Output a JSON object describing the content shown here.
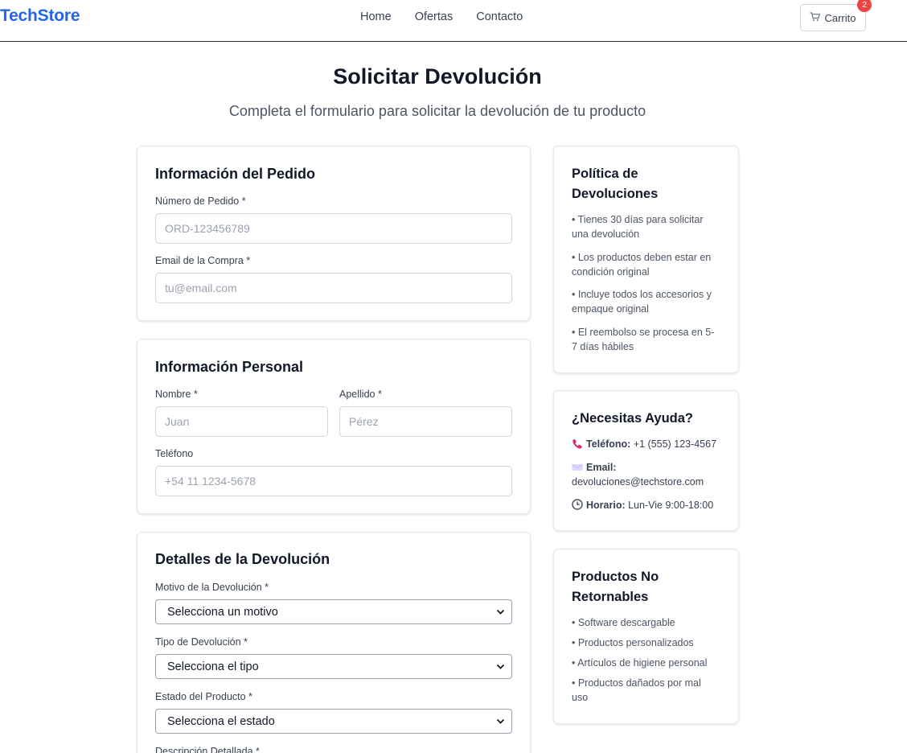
{
  "header": {
    "brand": "TechStore",
    "nav": [
      "Home",
      "Ofertas",
      "Contacto"
    ],
    "cart_label": "Carrito",
    "cart_count": "2"
  },
  "page": {
    "title": "Solicitar Devolución",
    "subtitle": "Completa el formulario para solicitar la devolución de tu producto"
  },
  "order_info": {
    "title": "Información del Pedido",
    "order_number_label": "Número de Pedido *",
    "order_number_placeholder": "ORD-123456789",
    "email_label": "Email de la Compra *",
    "email_placeholder": "tu@email.com"
  },
  "personal_info": {
    "title": "Información Personal",
    "first_name_label": "Nombre *",
    "first_name_placeholder": "Juan",
    "last_name_label": "Apellido *",
    "last_name_placeholder": "Pérez",
    "phone_label": "Teléfono",
    "phone_placeholder": "+54 11 1234-5678"
  },
  "return_details": {
    "title": "Detalles de la Devolución",
    "reason_label": "Motivo de la Devolución *",
    "reason_value": "Selecciona un motivo",
    "type_label": "Tipo de Devolución *",
    "type_value": "Selecciona el tipo",
    "condition_label": "Estado del Producto *",
    "condition_value": "Selecciona el estado",
    "description_label": "Descripción Detallada *"
  },
  "policy": {
    "title": "Política de Devoluciones",
    "items": [
      "• Tienes 30 días para solicitar una devolución",
      "• Los productos deben estar en condición original",
      "• Incluye todos los accesorios y empaque original",
      "• El reembolso se procesa en 5-7 días hábiles"
    ]
  },
  "help": {
    "title": "¿Necesitas Ayuda?",
    "phone_label": "Teléfono:",
    "phone_value": "+1 (555) 123-4567",
    "email_label": "Email:",
    "email_value": "devoluciones@techstore.com",
    "hours_label": "Horario:",
    "hours_value": "Lun-Vie 9:00-18:00"
  },
  "non_returnable": {
    "title": "Productos No Retornables",
    "items": [
      "• Software descargable",
      "• Productos personalizados",
      "• Artículos de higiene personal",
      "• Productos dañados por mal uso"
    ]
  },
  "colors": {
    "brand": "#2563eb",
    "badge": "#ef4444",
    "text": "#111827",
    "muted": "#4b5563",
    "border": "#d1d5db"
  },
  "icons": [
    "cart-icon",
    "phone-icon",
    "email-icon",
    "clock-icon",
    "chevron-down-icon"
  ]
}
